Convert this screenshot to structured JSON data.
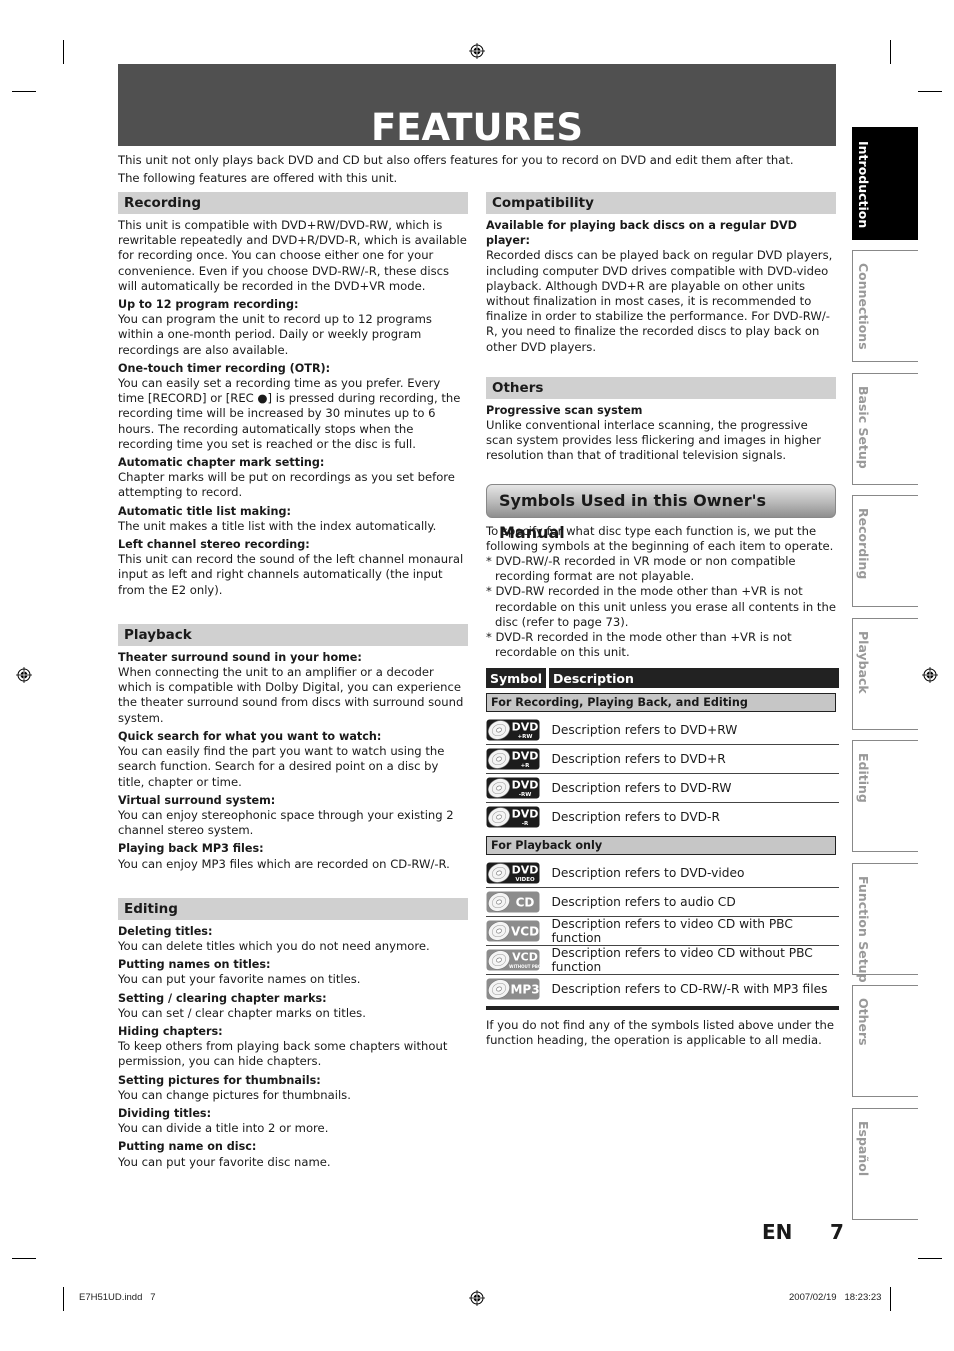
{
  "title": "FEATURES",
  "intro": [
    "This unit not only plays back DVD and CD but also offers features for you to record on DVD and edit them after that.",
    "The following features are offered with this unit."
  ],
  "recording": {
    "heading": "Recording",
    "lead": "This unit is compatible with DVD+RW/DVD-RW, which is rewritable repeatedly and DVD+R/DVD-R, which is available for recording once. You can choose either one for your convenience. Even if you choose DVD-RW/-R, these discs will automatically be recorded in the DVD+VR mode.",
    "items": [
      {
        "title": "Up to 12 program recording:",
        "body": "You can program the unit to record up to 12 programs within a one-month period. Daily or weekly program recordings are also available."
      },
      {
        "title": "One-touch timer recording (OTR):",
        "body": "You can easily set a recording time as you prefer. Every time [RECORD] or [REC ●] is pressed during recording, the recording time will be increased by 30 minutes up to 6 hours. The recording automatically stops when the recording time you set is reached or the disc is full."
      },
      {
        "title": "Automatic chapter mark setting:",
        "body": "Chapter marks will be put on recordings as you set before attempting to record."
      },
      {
        "title": "Automatic title list making:",
        "body": "The unit makes a title list with the index automatically."
      },
      {
        "title": "Left channel stereo recording:",
        "body": "This unit can record the sound of the left channel monaural input as left and right channels automatically (the input from the E2 only)."
      }
    ]
  },
  "playback": {
    "heading": "Playback",
    "items": [
      {
        "title": "Theater surround sound in your home:",
        "body": "When connecting the unit to an amplifier or a decoder which is compatible with Dolby Digital, you can experience the theater surround sound from discs with surround sound system."
      },
      {
        "title": "Quick search for what you want to watch:",
        "body": "You can easily find the part you want to watch using the search function. Search for a desired point on a disc by title, chapter or time."
      },
      {
        "title": "Virtual surround system:",
        "body": "You can enjoy stereophonic space through your existing 2 channel stereo system."
      },
      {
        "title": "Playing back MP3 files:",
        "body": "You can enjoy MP3 files which are recorded on CD-RW/-R."
      }
    ]
  },
  "editing": {
    "heading": "Editing",
    "items": [
      {
        "title": "Deleting titles:",
        "body": "You can delete titles which you do not need anymore."
      },
      {
        "title": "Putting names on titles:",
        "body": "You can put your favorite names on titles."
      },
      {
        "title": "Setting / clearing chapter marks:",
        "body": "You can set / clear chapter marks on titles."
      },
      {
        "title": "Hiding chapters:",
        "body": "To keep others from playing back some chapters without permission, you can hide chapters."
      },
      {
        "title": "Setting pictures for thumbnails:",
        "body": "You can change pictures for thumbnails."
      },
      {
        "title": "Dividing titles:",
        "body": "You can divide a title into 2 or more."
      },
      {
        "title": "Putting name on disc:",
        "body": "You can put your favorite disc name."
      }
    ]
  },
  "compatibility": {
    "heading": "Compatibility",
    "items": [
      {
        "title": "Available for playing back discs on a regular DVD player:",
        "body": "Recorded discs can be played back on regular DVD players, including computer DVD drives compatible with DVD-video playback. Although DVD+R are playable on other units without finalization in most cases, it is recommended to finalize in order to stabilize the performance. For DVD-RW/-R, you need to finalize the recorded discs to play back on other DVD players."
      }
    ]
  },
  "others": {
    "heading": "Others",
    "items": [
      {
        "title": "Progressive scan system",
        "body": "Unlike conventional interlace scanning, the progressive scan system provides less flickering and images in higher resolution than that of traditional television signals."
      }
    ]
  },
  "symbols": {
    "heading": "Symbols Used in this Owner's Manual",
    "lead": "To specify for what disc type each function is, we put the following symbols at the beginning of each item to operate.",
    "notes": [
      "* DVD-RW/-R recorded in VR mode or non compatible recording format are not playable.",
      "* DVD-RW recorded in the mode other than +VR is not recordable on this unit unless you erase all contents in the disc (refer to page 73).",
      "* DVD-R recorded in the mode other than +VR is not recordable on this unit."
    ],
    "table_headers": {
      "symbol": "Symbol",
      "description": "Description"
    },
    "categories": [
      {
        "label": "For Recording, Playing Back, and Editing",
        "rows": [
          {
            "icon": "dvd-plus-rw-icon",
            "main": "DVD",
            "sub": "+RW",
            "style": "dark",
            "desc": "Description refers to DVD+RW"
          },
          {
            "icon": "dvd-plus-r-icon",
            "main": "DVD",
            "sub": "+R",
            "style": "dark",
            "desc": "Description refers to DVD+R"
          },
          {
            "icon": "dvd-minus-rw-icon",
            "main": "DVD",
            "sub": "-RW",
            "style": "dark",
            "desc": "Description refers to DVD-RW"
          },
          {
            "icon": "dvd-minus-r-icon",
            "main": "DVD",
            "sub": "-R",
            "style": "dark",
            "desc": "Description refers to DVD-R"
          }
        ]
      },
      {
        "label": "For Playback only",
        "rows": [
          {
            "icon": "dvd-video-icon",
            "main": "DVD",
            "sub": "VIDEO",
            "style": "dark",
            "desc": "Description refers to DVD-video"
          },
          {
            "icon": "audio-cd-icon",
            "main": "CD",
            "sub": "",
            "style": "light",
            "desc": "Description refers to audio CD"
          },
          {
            "icon": "vcd-pbc-icon",
            "main": "VCD",
            "sub": "",
            "style": "light",
            "desc": "Description refers to video CD with PBC function"
          },
          {
            "icon": "vcd-no-pbc-icon",
            "main": "VCD",
            "sub": "WITHOUT PBC",
            "style": "light",
            "desc": "Description refers to video CD without PBC function"
          },
          {
            "icon": "mp3-icon",
            "main": "MP3",
            "sub": "",
            "style": "light",
            "desc": "Description refers to CD-RW/-R with MP3 files"
          }
        ]
      }
    ],
    "footer": "If you do not find any of the symbols listed above under the function heading, the operation is applicable to all media."
  },
  "side_tabs": [
    {
      "label": "Introduction",
      "active": true
    },
    {
      "label": "Connections",
      "active": false
    },
    {
      "label": "Basic Setup",
      "active": false
    },
    {
      "label": "Recording",
      "active": false
    },
    {
      "label": "Playback",
      "active": false
    },
    {
      "label": "Editing",
      "active": false
    },
    {
      "label": "Function Setup",
      "active": false
    },
    {
      "label": "Others",
      "active": false
    },
    {
      "label": "Español",
      "active": false
    }
  ],
  "page": {
    "lang": "EN",
    "number": "7"
  },
  "slug": {
    "file": "E7H51UD.indd   7",
    "timestamp": "2007/02/19   18:23:23"
  },
  "colors": {
    "title_bar": "#505050",
    "section_head": "#d0d0d0",
    "active_tab": "#000000",
    "inactive_tab_text": "#999999"
  }
}
